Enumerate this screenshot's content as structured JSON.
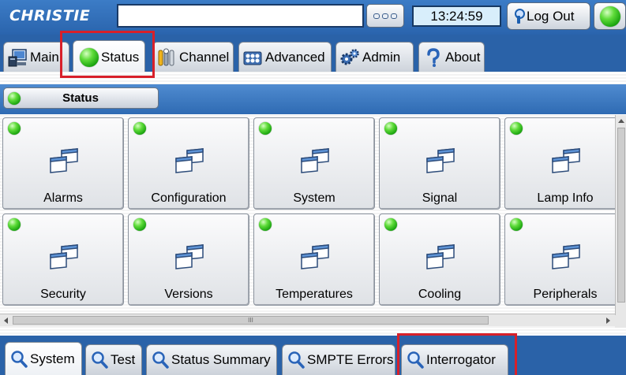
{
  "header": {
    "brand": "CHRISTIE",
    "address_value": "",
    "clock": "13:24:59",
    "logout_label": "Log Out"
  },
  "main_tabs": [
    {
      "label": "Main",
      "icon": "monitor-icon"
    },
    {
      "label": "Status",
      "icon": "green-led-icon",
      "active": true
    },
    {
      "label": "Channel",
      "icon": "tools-icon"
    },
    {
      "label": "Advanced",
      "icon": "rack-icon"
    },
    {
      "label": "Admin",
      "icon": "gears-icon"
    },
    {
      "label": "About",
      "icon": "question-icon"
    }
  ],
  "section": {
    "label": "Status"
  },
  "tiles": [
    {
      "label": "Alarms"
    },
    {
      "label": "Configuration"
    },
    {
      "label": "System"
    },
    {
      "label": "Signal"
    },
    {
      "label": "Lamp Info"
    },
    {
      "label": "Security"
    },
    {
      "label": "Versions"
    },
    {
      "label": "Temperatures"
    },
    {
      "label": "Cooling"
    },
    {
      "label": "Peripherals"
    }
  ],
  "scrollbar_grip": "III",
  "bottom_tabs": [
    {
      "label": "System",
      "active": true
    },
    {
      "label": "Test"
    },
    {
      "label": "Status Summary"
    },
    {
      "label": "SMPTE Errors"
    },
    {
      "label": "Interrogator"
    }
  ],
  "colors": {
    "background_blue": "#2a62a8",
    "led_green": "#18a20e",
    "highlight_red": "#d8202a"
  }
}
